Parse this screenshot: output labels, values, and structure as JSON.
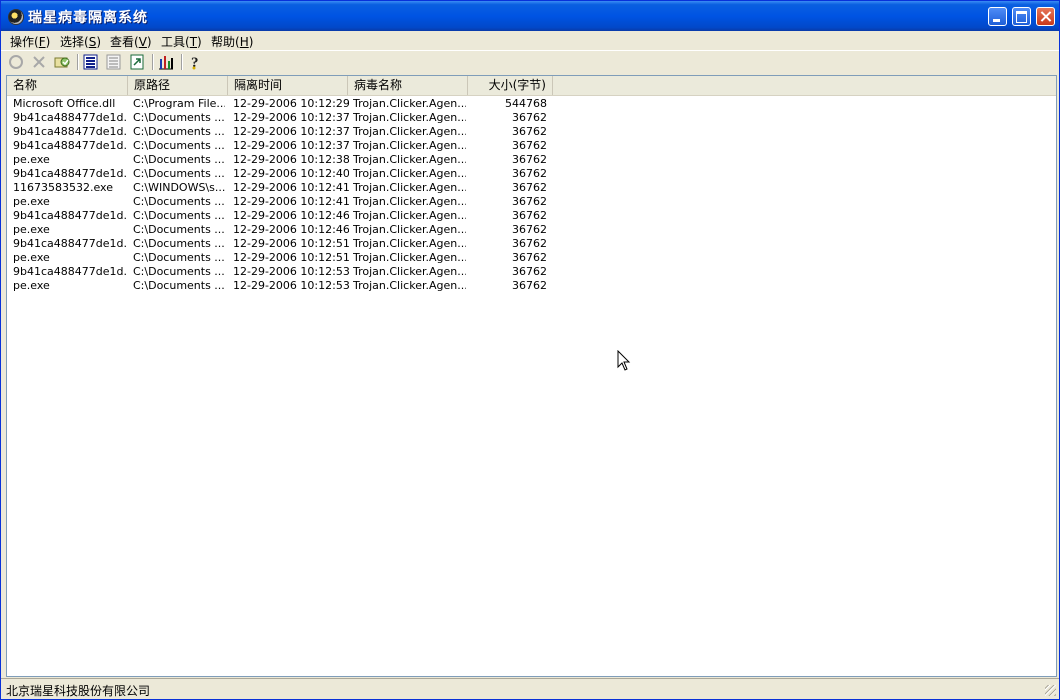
{
  "window": {
    "title": "瑞星病毒隔离系统"
  },
  "menu": [
    {
      "label": "操作(",
      "key": "F",
      "end": ")"
    },
    {
      "label": "选择(",
      "key": "S",
      "end": ")"
    },
    {
      "label": "查看(",
      "key": "V",
      "end": ")"
    },
    {
      "label": "工具(",
      "key": "T",
      "end": ")"
    },
    {
      "label": "帮助(",
      "key": "H",
      "end": ")"
    }
  ],
  "columns": [
    "名称",
    "原路径",
    "隔离时间",
    "病毒名称",
    "大小(字节)"
  ],
  "rows": [
    {
      "name": "Microsoft Office.dll",
      "path": "C:\\Program File...",
      "time": "12-29-2006 10:12:29",
      "virus": "Trojan.Clicker.Agen...",
      "size": "544768"
    },
    {
      "name": "9b41ca488477de1d...",
      "path": "C:\\Documents ...",
      "time": "12-29-2006 10:12:37",
      "virus": "Trojan.Clicker.Agen...",
      "size": "36762"
    },
    {
      "name": "9b41ca488477de1d...",
      "path": "C:\\Documents ...",
      "time": "12-29-2006 10:12:37",
      "virus": "Trojan.Clicker.Agen...",
      "size": "36762"
    },
    {
      "name": "9b41ca488477de1d...",
      "path": "C:\\Documents ...",
      "time": "12-29-2006 10:12:37",
      "virus": "Trojan.Clicker.Agen...",
      "size": "36762"
    },
    {
      "name": "pe.exe",
      "path": "C:\\Documents ...",
      "time": "12-29-2006 10:12:38",
      "virus": "Trojan.Clicker.Agen...",
      "size": "36762"
    },
    {
      "name": "9b41ca488477de1d...",
      "path": "C:\\Documents ...",
      "time": "12-29-2006 10:12:40",
      "virus": "Trojan.Clicker.Agen...",
      "size": "36762"
    },
    {
      "name": "11673583532.exe",
      "path": "C:\\WINDOWS\\s...",
      "time": "12-29-2006 10:12:41",
      "virus": "Trojan.Clicker.Agen...",
      "size": "36762"
    },
    {
      "name": "pe.exe",
      "path": "C:\\Documents ...",
      "time": "12-29-2006 10:12:41",
      "virus": "Trojan.Clicker.Agen...",
      "size": "36762"
    },
    {
      "name": "9b41ca488477de1d...",
      "path": "C:\\Documents ...",
      "time": "12-29-2006 10:12:46",
      "virus": "Trojan.Clicker.Agen...",
      "size": "36762"
    },
    {
      "name": "pe.exe",
      "path": "C:\\Documents ...",
      "time": "12-29-2006 10:12:46",
      "virus": "Trojan.Clicker.Agen...",
      "size": "36762"
    },
    {
      "name": "9b41ca488477de1d...",
      "path": "C:\\Documents ...",
      "time": "12-29-2006 10:12:51",
      "virus": "Trojan.Clicker.Agen...",
      "size": "36762"
    },
    {
      "name": "pe.exe",
      "path": "C:\\Documents ...",
      "time": "12-29-2006 10:12:51",
      "virus": "Trojan.Clicker.Agen...",
      "size": "36762"
    },
    {
      "name": "9b41ca488477de1d...",
      "path": "C:\\Documents ...",
      "time": "12-29-2006 10:12:53",
      "virus": "Trojan.Clicker.Agen...",
      "size": "36762"
    },
    {
      "name": "pe.exe",
      "path": "C:\\Documents ...",
      "time": "12-29-2006 10:12:53",
      "virus": "Trojan.Clicker.Agen...",
      "size": "36762"
    }
  ],
  "status": {
    "text": "北京瑞星科技股份有限公司"
  },
  "toolbar_icons": [
    "restore-icon",
    "delete-icon",
    "scan-icon",
    "view-list-icon",
    "view-details-icon",
    "export-icon",
    "chart-icon",
    "help-icon"
  ],
  "colors": {
    "titlebar": "#0054e3",
    "close_button": "#c8391a",
    "window_bg": "#ece9d8"
  }
}
